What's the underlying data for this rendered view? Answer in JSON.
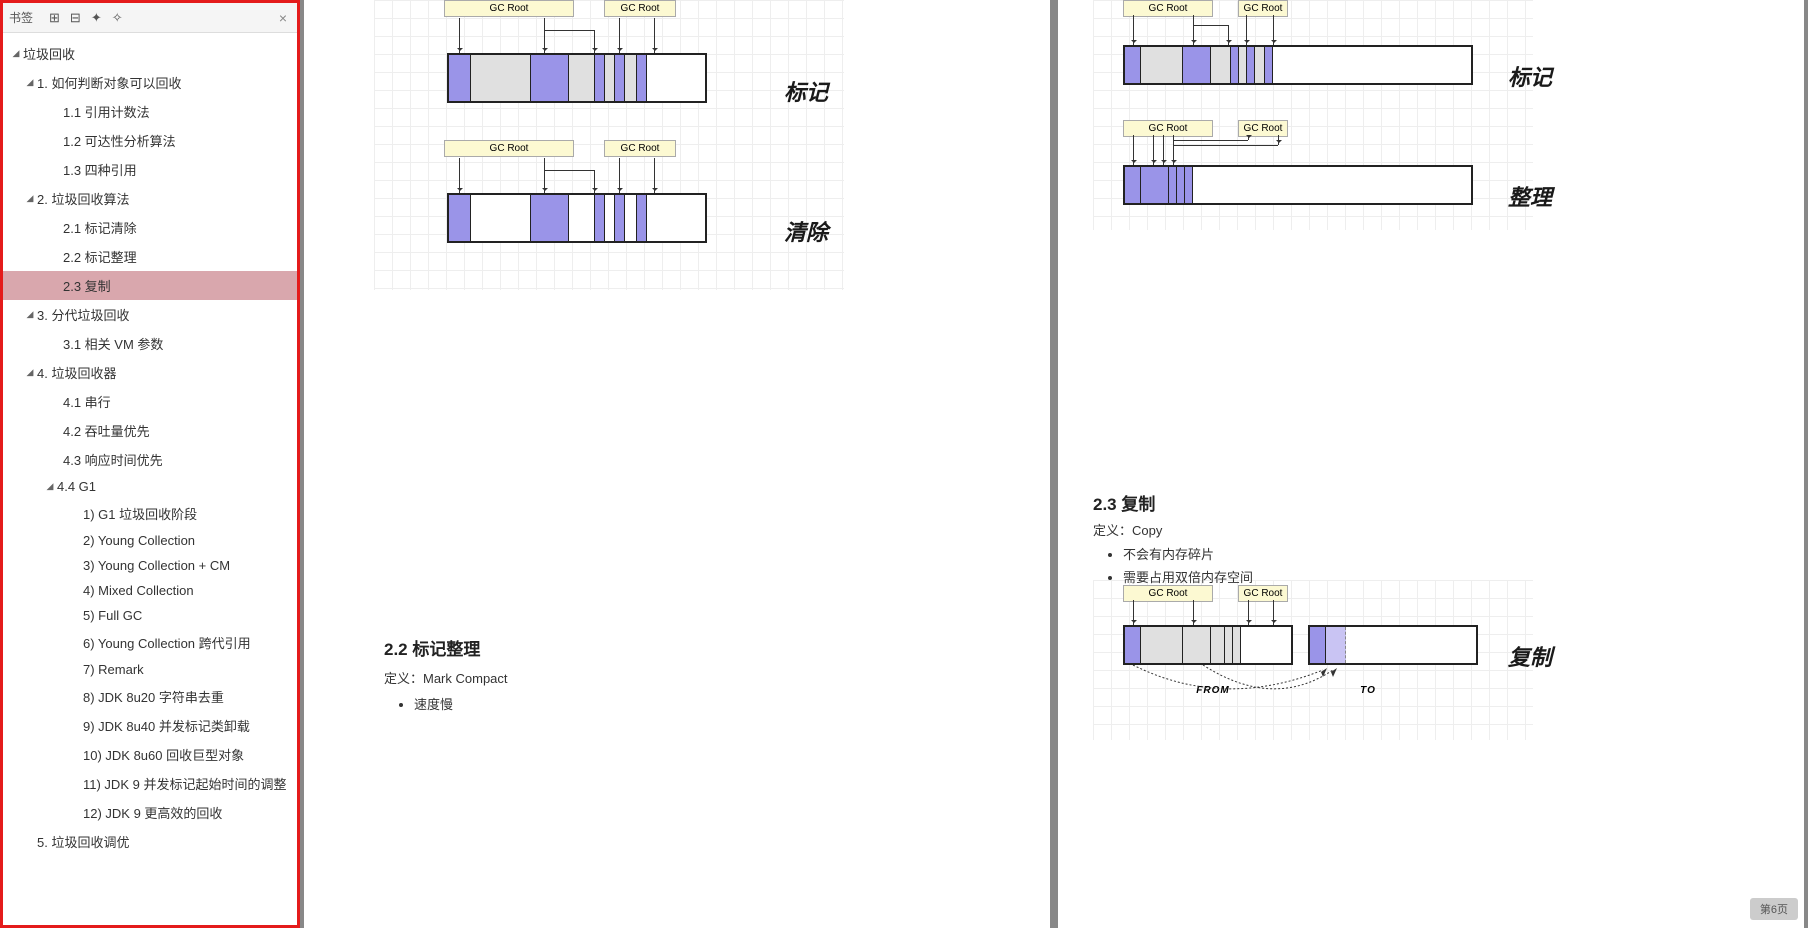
{
  "sidebar": {
    "tab_label": "书签",
    "close": "×",
    "tree": [
      {
        "lvl": 0,
        "expand": true,
        "label": "垃圾回收",
        "sel": false,
        "children": [
          {
            "lvl": 1,
            "expand": true,
            "label": "1. 如何判断对象可以回收",
            "children": [
              {
                "lvl": 2,
                "label": "1.1 引用计数法"
              },
              {
                "lvl": 2,
                "label": "1.2 可达性分析算法"
              },
              {
                "lvl": 2,
                "label": "1.3 四种引用"
              }
            ]
          },
          {
            "lvl": 1,
            "expand": true,
            "label": "2. 垃圾回收算法",
            "children": [
              {
                "lvl": 2,
                "label": "2.1 标记清除"
              },
              {
                "lvl": 2,
                "label": "2.2 标记整理"
              },
              {
                "lvl": 2,
                "label": "2.3 复制",
                "sel": true
              }
            ]
          },
          {
            "lvl": 1,
            "expand": true,
            "label": "3. 分代垃圾回收",
            "children": [
              {
                "lvl": 2,
                "label": "3.1 相关 VM 参数"
              }
            ]
          },
          {
            "lvl": 1,
            "expand": true,
            "label": "4. 垃圾回收器",
            "children": [
              {
                "lvl": 2,
                "label": "4.1 串行"
              },
              {
                "lvl": 2,
                "label": "4.2 吞吐量优先"
              },
              {
                "lvl": 2,
                "label": "4.3 响应时间优先"
              },
              {
                "lvl": 3,
                "expand": true,
                "label": "4.4 G1",
                "children": [
                  {
                    "lvl": 4,
                    "label": "1) G1 垃圾回收阶段"
                  },
                  {
                    "lvl": 4,
                    "label": "2) Young Collection"
                  },
                  {
                    "lvl": 4,
                    "label": "3) Young Collection + CM"
                  },
                  {
                    "lvl": 4,
                    "label": "4) Mixed Collection"
                  },
                  {
                    "lvl": 4,
                    "label": "5) Full GC"
                  },
                  {
                    "lvl": 4,
                    "label": "6) Young Collection 跨代引用"
                  },
                  {
                    "lvl": 4,
                    "label": "7) Remark"
                  },
                  {
                    "lvl": 4,
                    "label": "8) JDK 8u20 字符串去重"
                  },
                  {
                    "lvl": 4,
                    "label": "9) JDK 8u40 并发标记类卸载"
                  },
                  {
                    "lvl": 4,
                    "label": "10) JDK 8u60 回收巨型对象"
                  },
                  {
                    "lvl": 4,
                    "label": "11) JDK 9 并发标记起始时间的调整"
                  },
                  {
                    "lvl": 4,
                    "label": "12) JDK 9 更高效的回收"
                  }
                ]
              }
            ]
          },
          {
            "lvl": 1,
            "expand": false,
            "label": "5. 垃圾回收调优"
          }
        ]
      }
    ]
  },
  "page_left": {
    "gc_root": "GC Root",
    "label_mark": "标记",
    "label_sweep": "清除",
    "section_22": "2.2 标记整理",
    "def_22": "定义：Mark Compact",
    "bullet_22": "速度慢"
  },
  "page_right": {
    "gc_root": "GC Root",
    "label_mark": "标记",
    "label_compact": "整理",
    "label_copy": "复制",
    "section_23": "2.3 复制",
    "def_23": "定义：Copy",
    "bullets_23": [
      "不会有内存碎片",
      "需要占用双倍内存空间"
    ],
    "from": "FROM",
    "to": "TO"
  },
  "page_indicator": "第6页"
}
